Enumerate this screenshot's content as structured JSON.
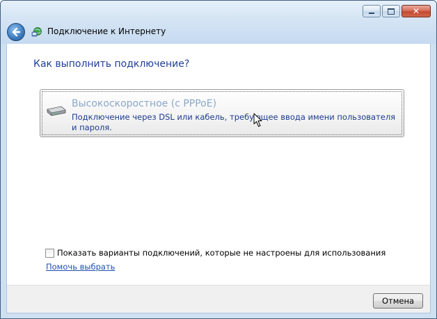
{
  "window": {
    "title": "Подключение к Интернету",
    "controls": {
      "minimize_icon": "minimize-icon",
      "maximize_icon": "maximize-icon",
      "close_label": "✕"
    }
  },
  "nav": {
    "back_icon": "back-arrow-icon",
    "app_icon": "network-globe-icon"
  },
  "main": {
    "heading": "Как выполнить подключение?",
    "options": [
      {
        "icon": "modem-icon",
        "title": "Высокоскоростное (с PPPoE)",
        "description": "Подключение через DSL или кабель, требующее ввода имени пользователя и пароля."
      }
    ],
    "show_unconfigured": {
      "label": "Показать варианты подключений, которые не настроены для использования",
      "checked": false
    },
    "help_link": "Помочь выбрать"
  },
  "footer": {
    "cancel_label": "Отмена"
  },
  "colors": {
    "heading": "#1e3f9a",
    "option_title": "#8aa7c9",
    "option_desc": "#1d3c8f",
    "link": "#1e4fb5",
    "close_button": "#c24a31"
  }
}
